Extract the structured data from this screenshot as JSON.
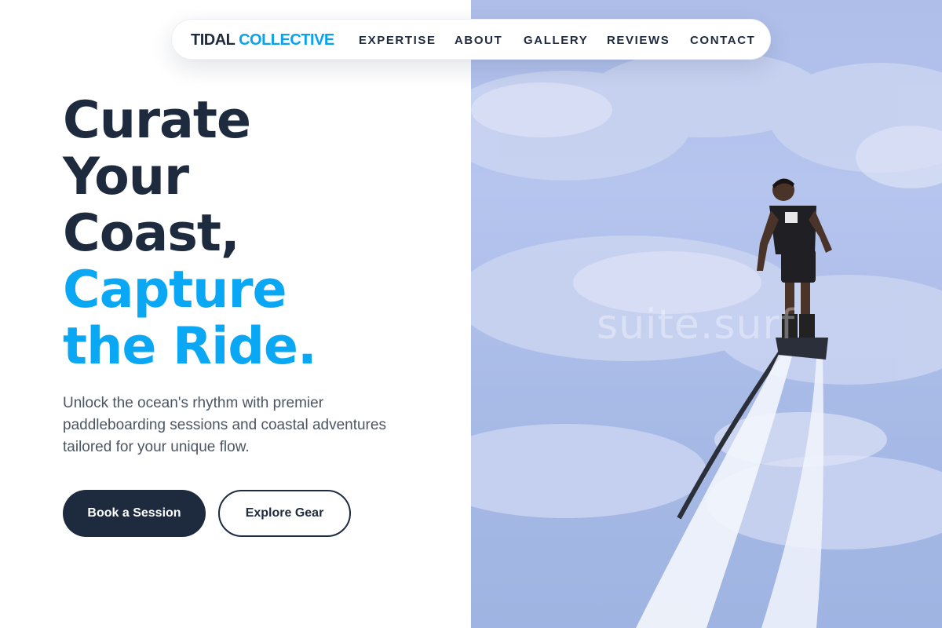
{
  "brand": {
    "name_part1": "TIDAL",
    "name_part2": "COLLECTIVE"
  },
  "nav": {
    "links": [
      "EXPERTISE",
      "ABOUT",
      "GALLERY",
      "REVIEWS",
      "CONTACT"
    ]
  },
  "hero": {
    "headline_line1": "Curate",
    "headline_line2": "Your",
    "headline_line3": "Coast,",
    "headline_line4": "Capture",
    "headline_line5": "the Ride.",
    "subtext": "Unlock the ocean's rhythm with premier paddleboarding sessions and coastal adventures tailored for your unique flow.",
    "primary_button": "Book a Session",
    "secondary_button": "Explore Gear"
  },
  "photo": {
    "watermark": "suite.surf"
  },
  "colors": {
    "dark": "#1e2a3e",
    "accent": "#0aa8f4",
    "sky": "#aebee9"
  }
}
